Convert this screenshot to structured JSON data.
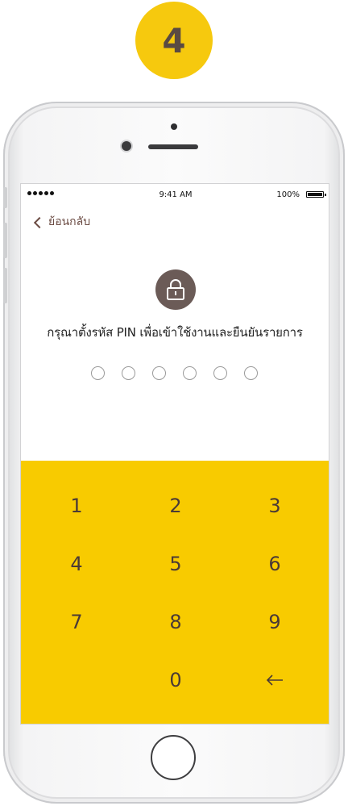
{
  "step": {
    "number": "4",
    "color": "#f6c90e"
  },
  "status_bar": {
    "time": "9:41 AM",
    "battery": "100%",
    "battery_level": 1.0
  },
  "nav": {
    "back_label": "ย้อนกลับ",
    "back_icon": "chevron-left-icon"
  },
  "lock": {
    "icon": "lock-icon",
    "color": "#6b5b57"
  },
  "prompt": "กรุณาตั้งรหัส PIN เพื่อเข้าใช้งานและยืนยันรายการ",
  "pin": {
    "length": 6,
    "filled": 0
  },
  "keypad": {
    "background": "#f8cb00",
    "keys": [
      "1",
      "2",
      "3",
      "4",
      "5",
      "6",
      "7",
      "8",
      "9",
      "0"
    ],
    "backspace_icon": "arrow-left-icon"
  }
}
